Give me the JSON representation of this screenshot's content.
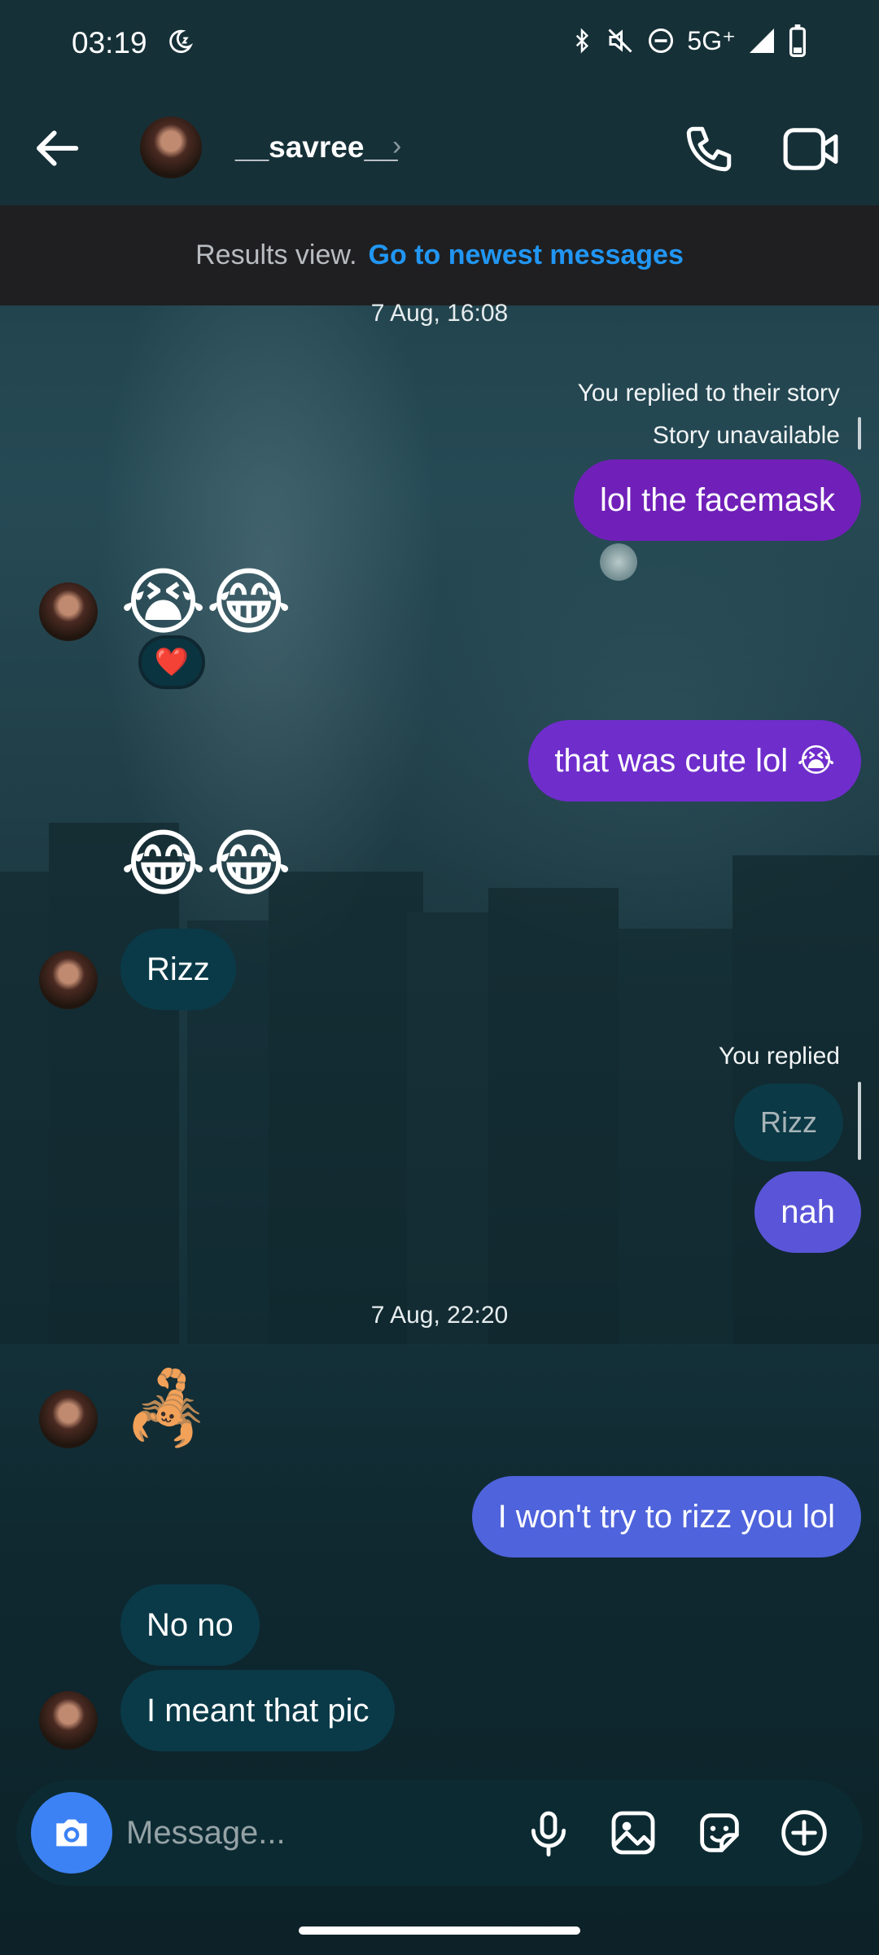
{
  "status_bar": {
    "time": "03:19",
    "network": "5G⁺"
  },
  "header": {
    "username": "__savree__"
  },
  "banner": {
    "text": "Results view.",
    "link": "Go to newest messages"
  },
  "messages": {
    "ts1": "7 Aug, 16:08",
    "story_meta": "You replied to their story",
    "story_unavailable": "Story unavailable",
    "msg_facemask": "lol the facemask",
    "emoji_reply": "😭😂",
    "reaction": "❤️",
    "msg_cute": "that was cute lol 😭",
    "emoji_laugh": "😂😂",
    "msg_rizz": "Rizz",
    "you_replied": "You replied",
    "quoted_rizz": "Rizz",
    "msg_nah": "nah",
    "ts2": "7 Aug, 22:20",
    "emoji_scorpion": "🦂",
    "msg_wont": "I won't try to rizz you lol",
    "msg_nono": "No no",
    "msg_meant": "I meant that pic"
  },
  "composer": {
    "placeholder": "Message..."
  },
  "colors": {
    "header_bg": "#163038",
    "banner_link": "#2196f3",
    "out_purple": "#7020b8",
    "out_blue": "#4f63dc",
    "in_bubble": "#0a3a48",
    "camera_button": "#3d82f5"
  }
}
